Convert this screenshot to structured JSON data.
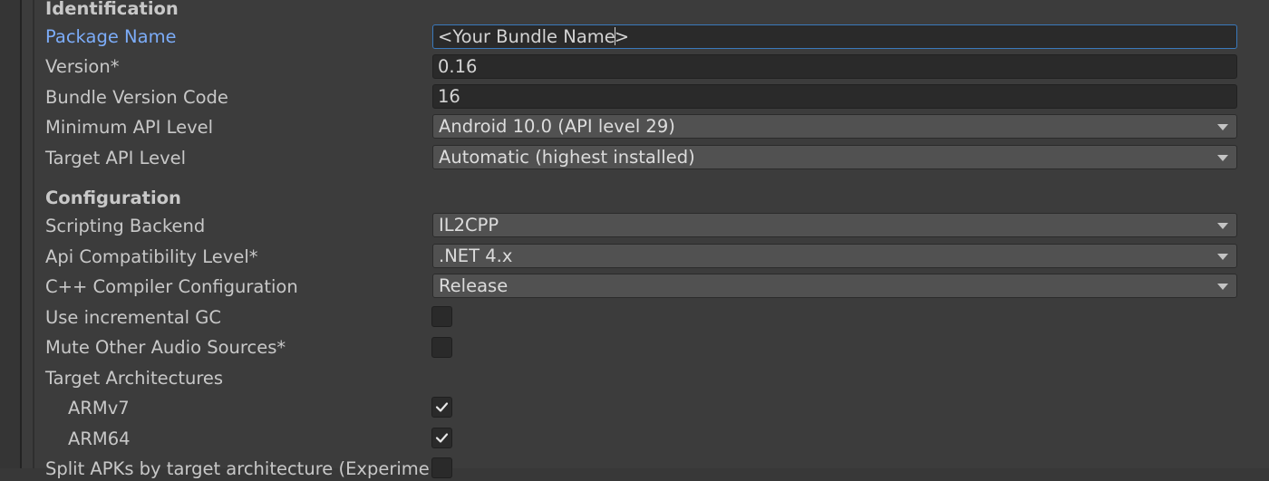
{
  "identification": {
    "header": "Identification",
    "package_name": {
      "label": "Package Name",
      "value_before_caret": "<Your Bundle Name",
      "value_after_caret": ">"
    },
    "version": {
      "label": "Version*",
      "value": "0.16"
    },
    "bundle_version_code": {
      "label": "Bundle Version Code",
      "value": "16"
    },
    "minimum_api_level": {
      "label": "Minimum API Level",
      "value": "Android 10.0 (API level 29)"
    },
    "target_api_level": {
      "label": "Target API Level",
      "value": "Automatic (highest installed)"
    }
  },
  "configuration": {
    "header": "Configuration",
    "scripting_backend": {
      "label": "Scripting Backend",
      "value": "IL2CPP"
    },
    "api_compatibility_level": {
      "label": "Api Compatibility Level*",
      "value": ".NET 4.x"
    },
    "cpp_compiler_configuration": {
      "label": "C++ Compiler Configuration",
      "value": "Release"
    },
    "use_incremental_gc": {
      "label": "Use incremental GC",
      "checked": false
    },
    "mute_other_audio_sources": {
      "label": "Mute Other Audio Sources*",
      "checked": false
    },
    "target_architectures": {
      "label": "Target Architectures",
      "armv7": {
        "label": "ARMv7",
        "checked": true
      },
      "arm64": {
        "label": "ARM64",
        "checked": true
      }
    },
    "split_apks": {
      "label": "Split APKs by target architecture (Experimental)",
      "checked": false
    }
  },
  "colors": {
    "focus_border": "#3a79bb",
    "highlight_label": "#7cacf8"
  }
}
